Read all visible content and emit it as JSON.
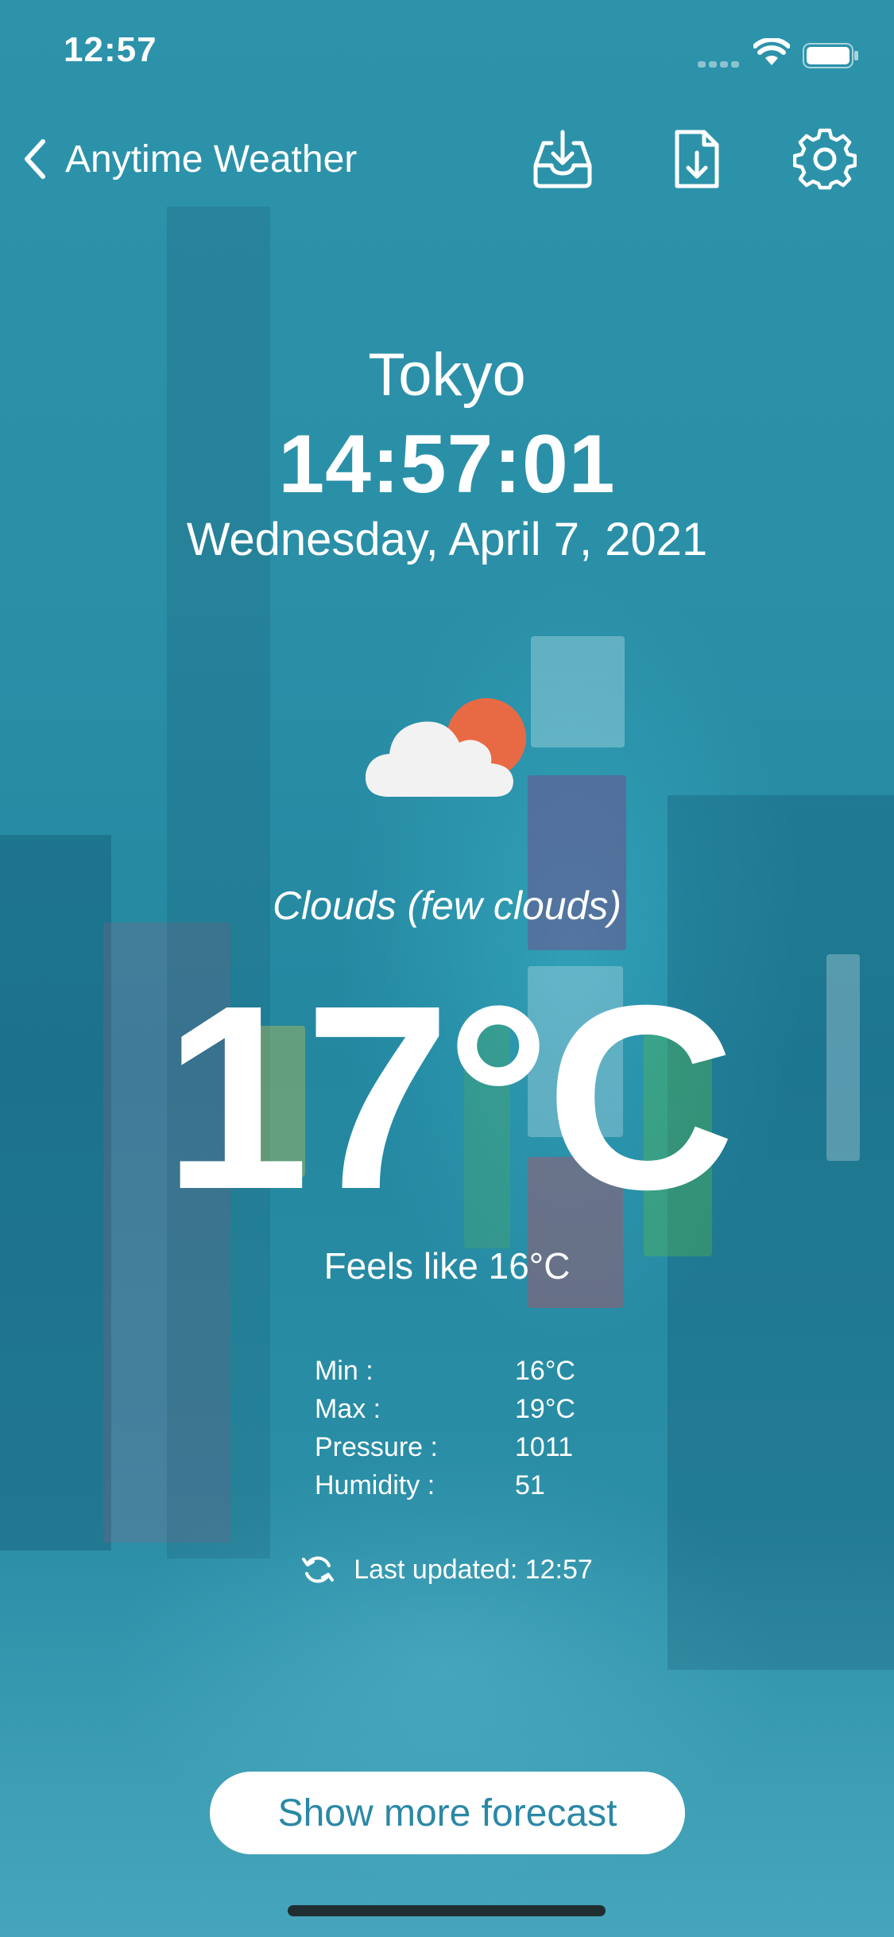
{
  "status_bar": {
    "time": "12:57"
  },
  "nav": {
    "back_label": "Anytime Weather",
    "icons": [
      "inbox-download-icon",
      "file-download-icon",
      "gear-icon"
    ]
  },
  "location": {
    "city": "Tokyo",
    "local_time": "14:57:01",
    "date": "Wednesday, April 7, 2021"
  },
  "weather": {
    "icon": "cloud-sun-icon",
    "condition": "Clouds (few clouds)",
    "temperature": "17°C",
    "feels_like": "Feels like 16°C",
    "details": [
      {
        "label": "Min :",
        "value": "16°C"
      },
      {
        "label": "Max :",
        "value": "19°C"
      },
      {
        "label": "Pressure :",
        "value": "1011"
      },
      {
        "label": "Humidity :",
        "value": "51"
      }
    ],
    "last_updated": "Last updated: 12:57"
  },
  "actions": {
    "forecast_button": "Show more forecast"
  },
  "colors": {
    "accent": "#2a88a6",
    "sun": "#e86a45",
    "cloud": "#f2f2f2"
  }
}
